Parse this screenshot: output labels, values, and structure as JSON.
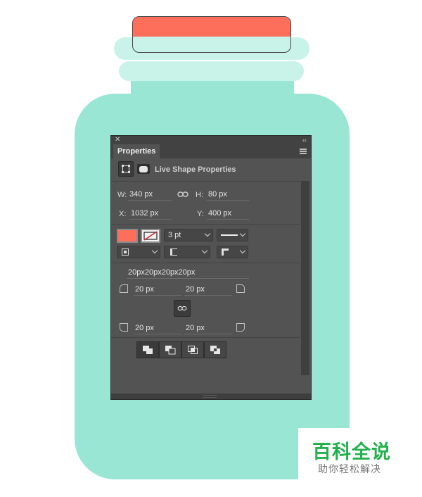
{
  "panel": {
    "tab_label": "Properties",
    "header_title": "Live Shape Properties",
    "close_glyph": "✕",
    "collapse_glyph": "‹‹"
  },
  "transform": {
    "w_label": "W:",
    "w_value": "340 px",
    "h_label": "H:",
    "h_value": "80 px",
    "x_label": "X:",
    "x_value": "1032 px",
    "y_label": "Y:",
    "y_value": "400 px"
  },
  "appearance": {
    "fill_color": "#fe6f5b",
    "stroke_width": "3 pt"
  },
  "corners": {
    "summary": "20px20px20px20px",
    "top_left": "20 px",
    "top_right": "20 px",
    "bottom_left": "20 px",
    "bottom_right": "20 px"
  },
  "watermark": {
    "title": "百科全说",
    "subtitle": "助你轻松解决"
  },
  "colors": {
    "jar_body": "#99e6d4",
    "jar_light": "#c9f3e9",
    "lid": "#fe6f5b",
    "panel_bg": "#535353",
    "watermark_green": "#22b14c"
  }
}
